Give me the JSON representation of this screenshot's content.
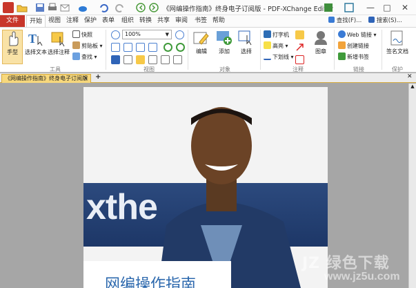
{
  "window": {
    "title": "《网编操作指南》终身电子订阅版 - PDF-XChange Editor",
    "controls": [
      "—",
      "□",
      "✕"
    ]
  },
  "menu_tabs": [
    "文件",
    "开始",
    "视图",
    "注释",
    "保护",
    "表单",
    "组织",
    "转换",
    "共享",
    "审阅",
    "书签",
    "帮助"
  ],
  "find": {
    "label": "查找(F)...",
    "search_label": "搜索(S)..."
  },
  "ribbon": {
    "tools": {
      "hand": "手型",
      "select_text": "选择文本",
      "select_comment": "选择注释",
      "snapshot": "快照",
      "clipboard": "剪贴板",
      "find": "查找",
      "group": "工具"
    },
    "view": {
      "zoom": "100%",
      "group": "视图"
    },
    "objects": {
      "edit": "编辑",
      "add": "添加",
      "select": "选择",
      "group": "对象"
    },
    "comments": {
      "typewriter": "打字机",
      "highlight": "高亮",
      "underline": "下划线",
      "stamp": "图章",
      "group": "注释"
    },
    "links": {
      "web_links": "Web 链接",
      "create_link": "创建链接",
      "new_bookmark": "新增书签",
      "group": "链接"
    },
    "protect": {
      "sign": "签名文档",
      "group": "保护"
    }
  },
  "doc_tab": {
    "label": "《网编操作指南》终身电子订阅版",
    "close": "✕"
  },
  "document": {
    "banner_text": "xthe",
    "cover_title": "网编操作指南"
  },
  "watermark": {
    "line1": "JZ 绿色下载",
    "line2": "www.jz5u.com"
  },
  "colors": {
    "accent_file": "#c8362a",
    "doc_tab": "#f7d87c",
    "banner": "#2c4a7e",
    "cover_title": "#2c68ad"
  }
}
